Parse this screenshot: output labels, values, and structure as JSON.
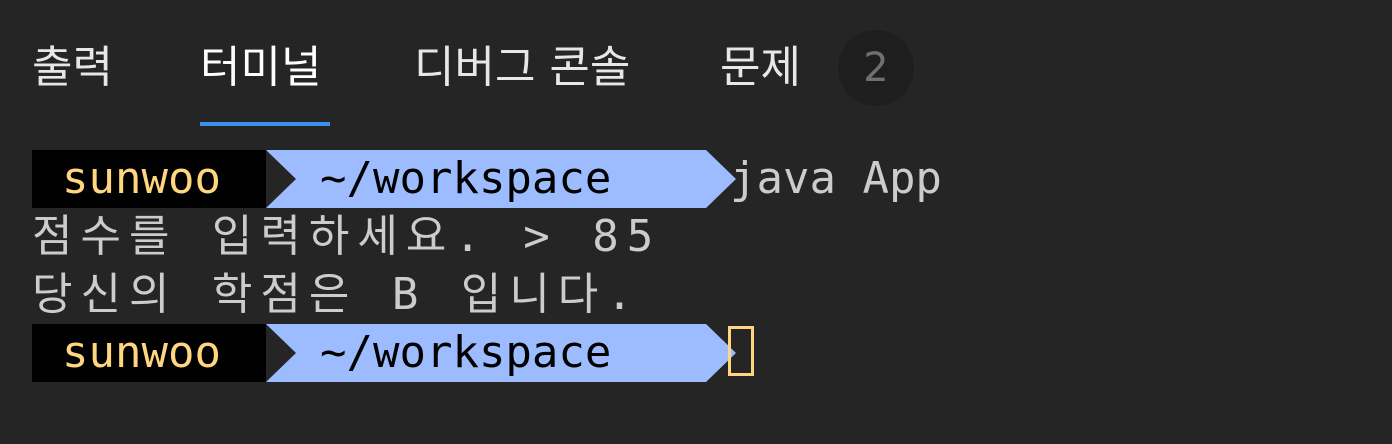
{
  "tabs": [
    {
      "label": "출력"
    },
    {
      "label": "터미널"
    },
    {
      "label": "디버그 콘솔"
    },
    {
      "label": "문제"
    }
  ],
  "active_tab": "터미널",
  "problems_count": "2",
  "terminal": {
    "lines": [
      {
        "user": "sunwoo",
        "path": "~/workspace",
        "command": "java App"
      },
      {
        "output": "점수를 입력하세요. > 85"
      },
      {
        "output": "당신의 학점은 B 입니다."
      },
      {
        "user": "sunwoo",
        "path": "~/workspace",
        "command": ""
      }
    ]
  },
  "colors": {
    "background": "#252526",
    "active_tab_underline": "#3b8eea",
    "prompt_user_bg": "#000000",
    "prompt_user_fg": "#ffd580",
    "prompt_path_bg": "#9cbcff",
    "cursor": "#ffd580"
  },
  "icons": {
    "cursor": "block-cursor-outline"
  }
}
